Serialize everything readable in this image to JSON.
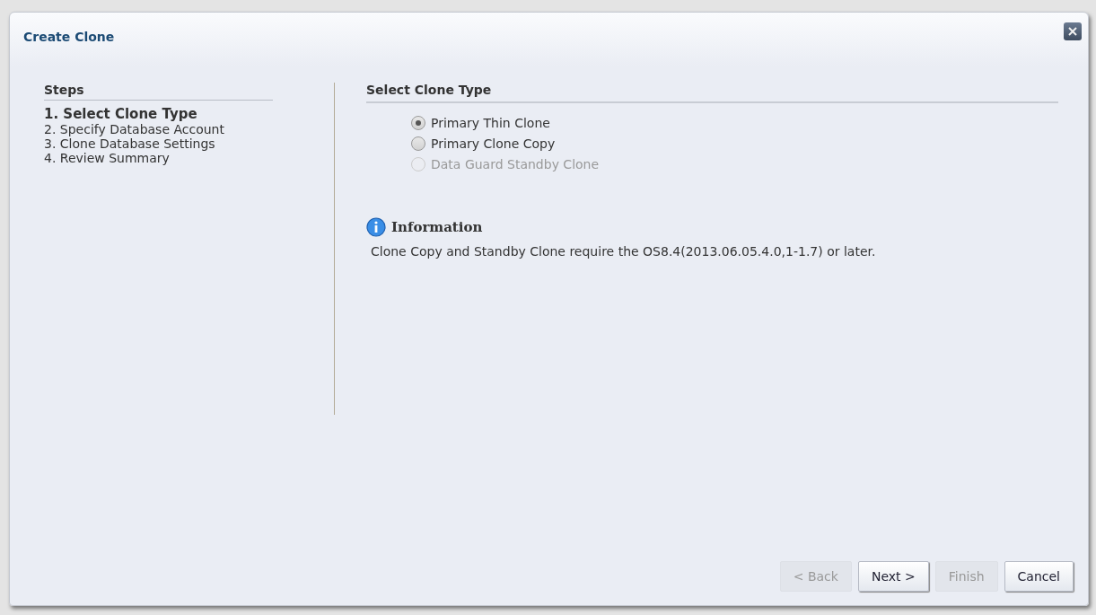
{
  "dialog": {
    "title": "Create Clone"
  },
  "steps": {
    "heading": "Steps",
    "items": [
      {
        "label": "1. Select Clone Type",
        "selected": true
      },
      {
        "label": "2. Specify Database Account",
        "selected": false
      },
      {
        "label": "3. Clone Database Settings",
        "selected": false
      },
      {
        "label": "4. Review Summary",
        "selected": false
      }
    ]
  },
  "section": {
    "heading": "Select Clone Type",
    "options": [
      {
        "label": "Primary Thin Clone",
        "selected": true,
        "disabled": false
      },
      {
        "label": "Primary Clone Copy",
        "selected": false,
        "disabled": false
      },
      {
        "label": "Data Guard Standby Clone",
        "selected": false,
        "disabled": true
      }
    ]
  },
  "information": {
    "title": "Information",
    "text": "Clone Copy and Standby Clone require the OS8.4(2013.06.05.4.0,1-1.7) or later."
  },
  "buttons": [
    {
      "label": "< Back",
      "disabled": true
    },
    {
      "label": "Next >",
      "disabled": false
    },
    {
      "label": "Finish",
      "disabled": true
    },
    {
      "label": "Cancel",
      "disabled": false
    }
  ]
}
